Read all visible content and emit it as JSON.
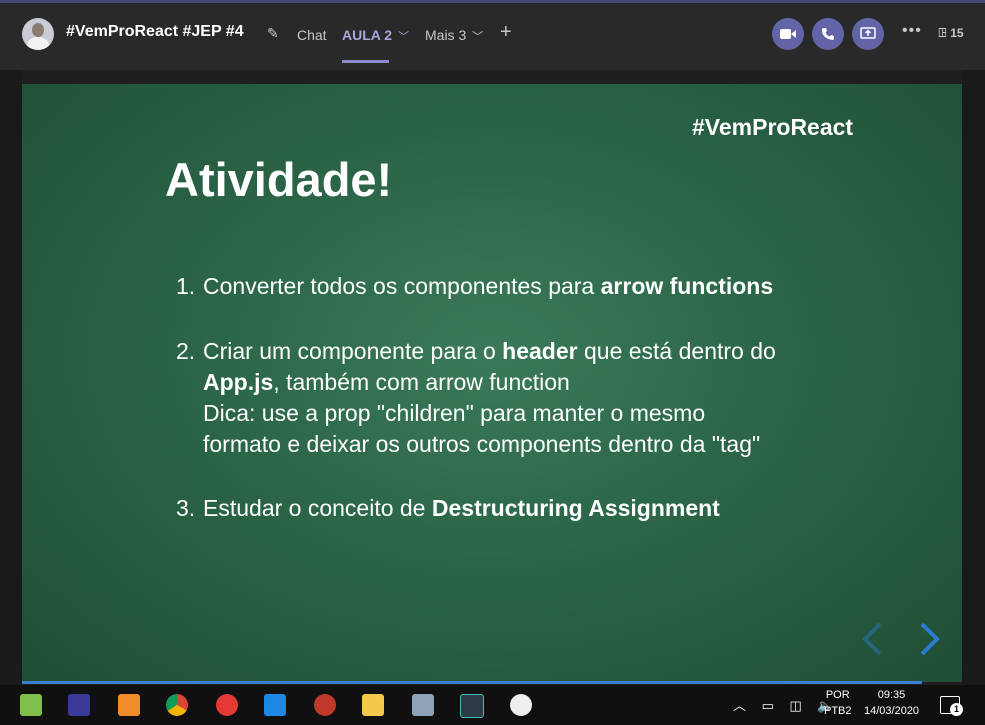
{
  "header": {
    "channel_title": "#VemProReact #JEP #4",
    "tabs": [
      {
        "label": "Chat"
      },
      {
        "label": "AULA 2"
      },
      {
        "label": "Mais 3"
      }
    ],
    "participant_count": "15"
  },
  "slide": {
    "hashtag": "#VemProReact",
    "title": "Atividade!",
    "items": [
      {
        "num": "1.",
        "pre": "Converter todos os componentes para ",
        "bold": "arrow functions"
      },
      {
        "num": "2.",
        "pre": "Criar um componente para o ",
        "bold": "header",
        "post": " que está dentro do",
        "line2_bold": "App.js",
        "line2_rest": ", também com arrow function",
        "line3": "Dica: use a prop \"children\" para manter o mesmo",
        "line4": "formato e deixar os outros components dentro da \"tag\""
      },
      {
        "num": "3.",
        "pre": "Estudar o conceito de ",
        "bold": "Destructuring Assignment"
      }
    ]
  },
  "taskbar": {
    "language": "POR",
    "layout": "PTB2",
    "time": "09:35",
    "date": "14/03/2020",
    "notification_count": "1"
  },
  "colors": {
    "accent": "#6264a7",
    "slide_green": "#2b6447",
    "nav_blue": "#2b7bd2"
  }
}
